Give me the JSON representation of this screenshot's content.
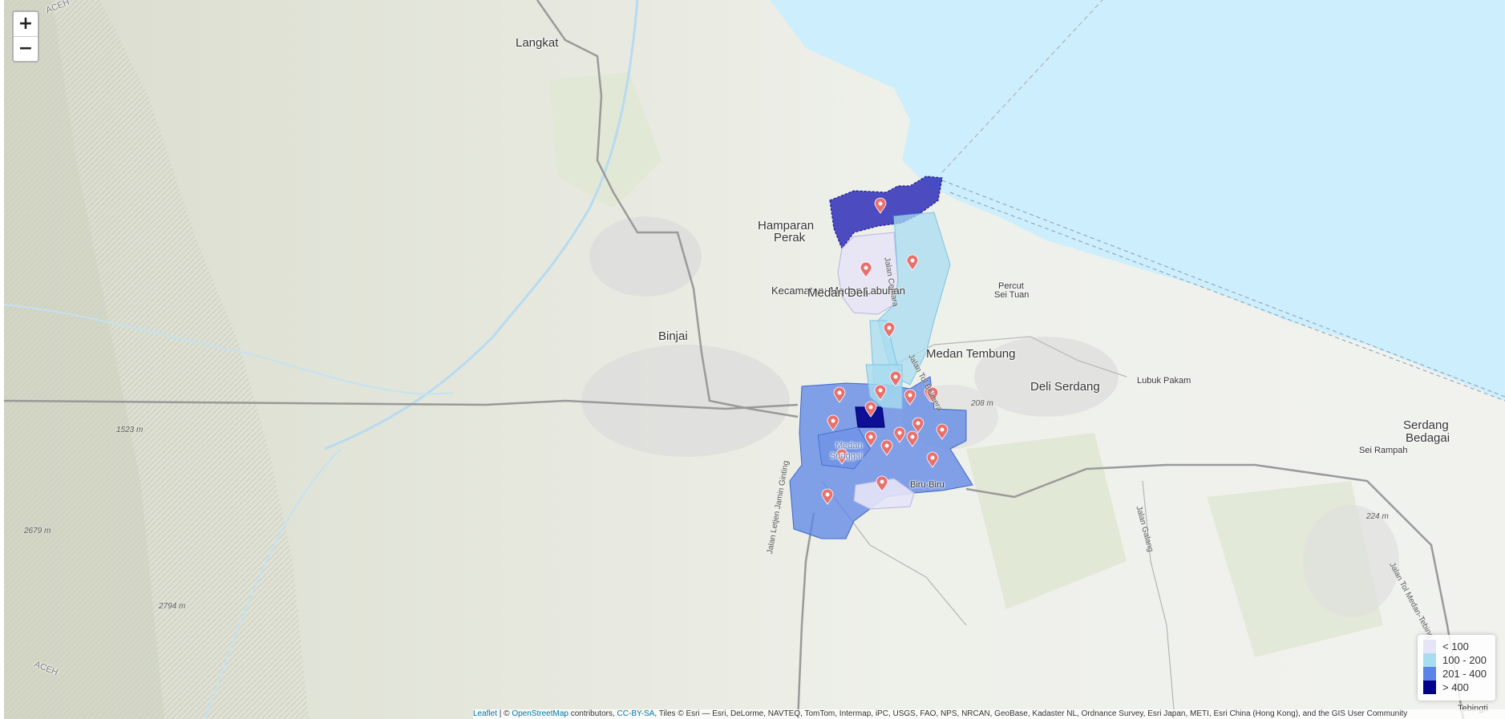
{
  "map": {
    "zoom_in_label": "+",
    "zoom_out_label": "−",
    "tooltip": "Kecamatan: Medan Labuhan",
    "places": {
      "langkat": "Langkat",
      "hamparan": "Hamparan",
      "perak": "Perak",
      "medan_deli": "Medan Deli",
      "binjai": "Binjai",
      "percut": "Percut",
      "sei_tuan": "Sei Tuan",
      "medan_tembung": "Medan Tembung",
      "deli_serdang": "Deli Serdang",
      "lubuk_pakam": "Lubuk Pakam",
      "serdang": "Serdang",
      "bedagai": "Bedagai",
      "sei_rampah": "Sei Rampah",
      "biru_biru": "Biru-Biru",
      "medan_prefix": "Medan",
      "sunggal": "Sunggal",
      "aceh_top": "ACEH",
      "aceh_bottom": "ACEH",
      "tebing": "Tebingti"
    },
    "elevations": {
      "e1523": "1523 m",
      "e2679": "2679 m",
      "e2794": "2794 m",
      "e208": "208 m",
      "e224": "224 m"
    },
    "roads": {
      "jamin_ginting": "Jalan Letjen Jamin Ginting",
      "tol_belmera": "Jalan Tol Belmera",
      "jalan_cemara": "Jalan Cemara",
      "jalan_galang": "Jalan Galang",
      "tol_medan_tebing": "Jalan Tol Medan-Tebing"
    }
  },
  "legend": {
    "items": [
      {
        "label": "< 100",
        "color": "#e6e4f7"
      },
      {
        "label": "100 - 200",
        "color": "#a8dcf0"
      },
      {
        "label": "201 - 400",
        "color": "#5b84e6"
      },
      {
        "label": "> 400",
        "color": "#00008b"
      }
    ]
  },
  "attribution": {
    "leaflet": "Leaflet",
    "sep1": " | © ",
    "osm": "OpenStreetMap",
    "contributors": " contributors, ",
    "ccbysa": "CC-BY-SA",
    "tiles": ", Tiles © Esri — Esri, DeLorme, NAVTEQ, TomTom, Intermap, iPC, USGS, FAO, NPS, NRCAN, GeoBase, Kadaster NL, Ordnance Survey, Esri Japan, METI, Esri China (Hong Kong), and the GIS User Community"
  }
}
